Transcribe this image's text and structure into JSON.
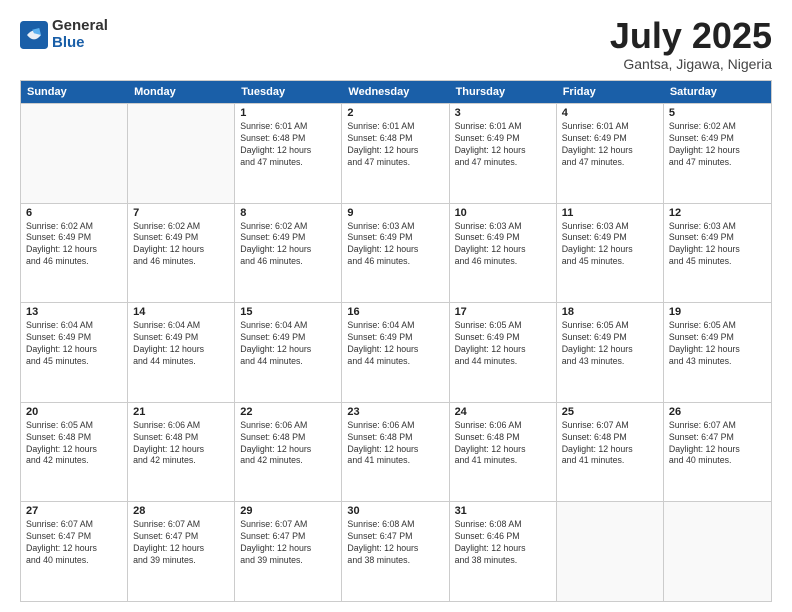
{
  "logo": {
    "general": "General",
    "blue": "Blue"
  },
  "title": {
    "month_year": "July 2025",
    "location": "Gantsa, Jigawa, Nigeria"
  },
  "weekdays": [
    "Sunday",
    "Monday",
    "Tuesday",
    "Wednesday",
    "Thursday",
    "Friday",
    "Saturday"
  ],
  "rows": [
    [
      {
        "day": "",
        "lines": []
      },
      {
        "day": "",
        "lines": []
      },
      {
        "day": "1",
        "lines": [
          "Sunrise: 6:01 AM",
          "Sunset: 6:48 PM",
          "Daylight: 12 hours",
          "and 47 minutes."
        ]
      },
      {
        "day": "2",
        "lines": [
          "Sunrise: 6:01 AM",
          "Sunset: 6:48 PM",
          "Daylight: 12 hours",
          "and 47 minutes."
        ]
      },
      {
        "day": "3",
        "lines": [
          "Sunrise: 6:01 AM",
          "Sunset: 6:49 PM",
          "Daylight: 12 hours",
          "and 47 minutes."
        ]
      },
      {
        "day": "4",
        "lines": [
          "Sunrise: 6:01 AM",
          "Sunset: 6:49 PM",
          "Daylight: 12 hours",
          "and 47 minutes."
        ]
      },
      {
        "day": "5",
        "lines": [
          "Sunrise: 6:02 AM",
          "Sunset: 6:49 PM",
          "Daylight: 12 hours",
          "and 47 minutes."
        ]
      }
    ],
    [
      {
        "day": "6",
        "lines": [
          "Sunrise: 6:02 AM",
          "Sunset: 6:49 PM",
          "Daylight: 12 hours",
          "and 46 minutes."
        ]
      },
      {
        "day": "7",
        "lines": [
          "Sunrise: 6:02 AM",
          "Sunset: 6:49 PM",
          "Daylight: 12 hours",
          "and 46 minutes."
        ]
      },
      {
        "day": "8",
        "lines": [
          "Sunrise: 6:02 AM",
          "Sunset: 6:49 PM",
          "Daylight: 12 hours",
          "and 46 minutes."
        ]
      },
      {
        "day": "9",
        "lines": [
          "Sunrise: 6:03 AM",
          "Sunset: 6:49 PM",
          "Daylight: 12 hours",
          "and 46 minutes."
        ]
      },
      {
        "day": "10",
        "lines": [
          "Sunrise: 6:03 AM",
          "Sunset: 6:49 PM",
          "Daylight: 12 hours",
          "and 46 minutes."
        ]
      },
      {
        "day": "11",
        "lines": [
          "Sunrise: 6:03 AM",
          "Sunset: 6:49 PM",
          "Daylight: 12 hours",
          "and 45 minutes."
        ]
      },
      {
        "day": "12",
        "lines": [
          "Sunrise: 6:03 AM",
          "Sunset: 6:49 PM",
          "Daylight: 12 hours",
          "and 45 minutes."
        ]
      }
    ],
    [
      {
        "day": "13",
        "lines": [
          "Sunrise: 6:04 AM",
          "Sunset: 6:49 PM",
          "Daylight: 12 hours",
          "and 45 minutes."
        ]
      },
      {
        "day": "14",
        "lines": [
          "Sunrise: 6:04 AM",
          "Sunset: 6:49 PM",
          "Daylight: 12 hours",
          "and 44 minutes."
        ]
      },
      {
        "day": "15",
        "lines": [
          "Sunrise: 6:04 AM",
          "Sunset: 6:49 PM",
          "Daylight: 12 hours",
          "and 44 minutes."
        ]
      },
      {
        "day": "16",
        "lines": [
          "Sunrise: 6:04 AM",
          "Sunset: 6:49 PM",
          "Daylight: 12 hours",
          "and 44 minutes."
        ]
      },
      {
        "day": "17",
        "lines": [
          "Sunrise: 6:05 AM",
          "Sunset: 6:49 PM",
          "Daylight: 12 hours",
          "and 44 minutes."
        ]
      },
      {
        "day": "18",
        "lines": [
          "Sunrise: 6:05 AM",
          "Sunset: 6:49 PM",
          "Daylight: 12 hours",
          "and 43 minutes."
        ]
      },
      {
        "day": "19",
        "lines": [
          "Sunrise: 6:05 AM",
          "Sunset: 6:49 PM",
          "Daylight: 12 hours",
          "and 43 minutes."
        ]
      }
    ],
    [
      {
        "day": "20",
        "lines": [
          "Sunrise: 6:05 AM",
          "Sunset: 6:48 PM",
          "Daylight: 12 hours",
          "and 42 minutes."
        ]
      },
      {
        "day": "21",
        "lines": [
          "Sunrise: 6:06 AM",
          "Sunset: 6:48 PM",
          "Daylight: 12 hours",
          "and 42 minutes."
        ]
      },
      {
        "day": "22",
        "lines": [
          "Sunrise: 6:06 AM",
          "Sunset: 6:48 PM",
          "Daylight: 12 hours",
          "and 42 minutes."
        ]
      },
      {
        "day": "23",
        "lines": [
          "Sunrise: 6:06 AM",
          "Sunset: 6:48 PM",
          "Daylight: 12 hours",
          "and 41 minutes."
        ]
      },
      {
        "day": "24",
        "lines": [
          "Sunrise: 6:06 AM",
          "Sunset: 6:48 PM",
          "Daylight: 12 hours",
          "and 41 minutes."
        ]
      },
      {
        "day": "25",
        "lines": [
          "Sunrise: 6:07 AM",
          "Sunset: 6:48 PM",
          "Daylight: 12 hours",
          "and 41 minutes."
        ]
      },
      {
        "day": "26",
        "lines": [
          "Sunrise: 6:07 AM",
          "Sunset: 6:47 PM",
          "Daylight: 12 hours",
          "and 40 minutes."
        ]
      }
    ],
    [
      {
        "day": "27",
        "lines": [
          "Sunrise: 6:07 AM",
          "Sunset: 6:47 PM",
          "Daylight: 12 hours",
          "and 40 minutes."
        ]
      },
      {
        "day": "28",
        "lines": [
          "Sunrise: 6:07 AM",
          "Sunset: 6:47 PM",
          "Daylight: 12 hours",
          "and 39 minutes."
        ]
      },
      {
        "day": "29",
        "lines": [
          "Sunrise: 6:07 AM",
          "Sunset: 6:47 PM",
          "Daylight: 12 hours",
          "and 39 minutes."
        ]
      },
      {
        "day": "30",
        "lines": [
          "Sunrise: 6:08 AM",
          "Sunset: 6:47 PM",
          "Daylight: 12 hours",
          "and 38 minutes."
        ]
      },
      {
        "day": "31",
        "lines": [
          "Sunrise: 6:08 AM",
          "Sunset: 6:46 PM",
          "Daylight: 12 hours",
          "and 38 minutes."
        ]
      },
      {
        "day": "",
        "lines": []
      },
      {
        "day": "",
        "lines": []
      }
    ]
  ]
}
